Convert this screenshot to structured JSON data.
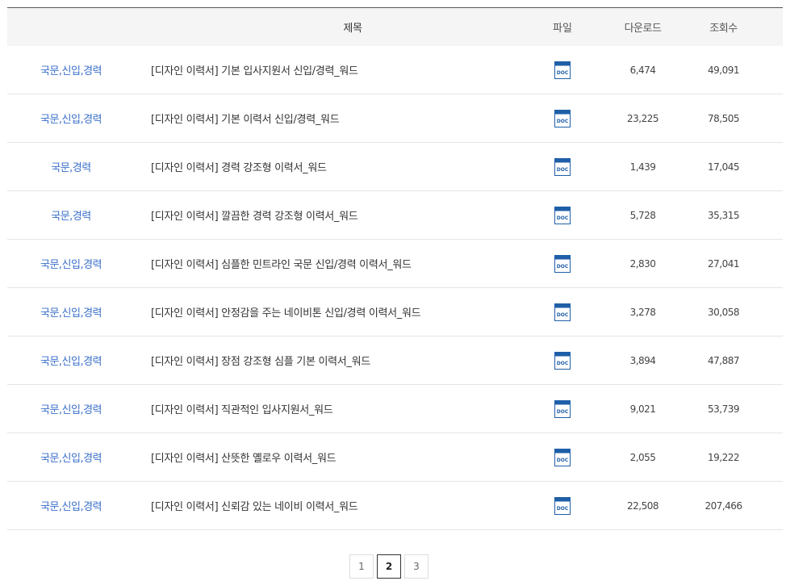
{
  "table": {
    "headers": {
      "category": "",
      "title": "제목",
      "file": "파일",
      "downloads": "다운로드",
      "views": "조회수"
    },
    "rows": [
      {
        "category": "국문,신입,경력",
        "title": "[디자인 이력서] 기본 입사지원서 신입/경력_워드",
        "file_icon": "doc-file-icon",
        "downloads": "6,474",
        "views": "49,091"
      },
      {
        "category": "국문,신입,경력",
        "title": "[디자인 이력서] 기본 이력서 신입/경력_워드",
        "file_icon": "doc-file-icon",
        "downloads": "23,225",
        "views": "78,505"
      },
      {
        "category": "국문,경력",
        "title": "[디자인 이력서] 경력 강조형 이력서_워드",
        "file_icon": "doc-file-icon",
        "downloads": "1,439",
        "views": "17,045"
      },
      {
        "category": "국문,경력",
        "title": "[디자인 이력서] 깔끔한 경력 강조형 이력서_워드",
        "file_icon": "doc-file-icon",
        "downloads": "5,728",
        "views": "35,315"
      },
      {
        "category": "국문,신입,경력",
        "title": "[디자인 이력서] 심플한 민트라인 국문 신입/경력 이력서_워드",
        "file_icon": "doc-file-icon",
        "downloads": "2,830",
        "views": "27,041"
      },
      {
        "category": "국문,신입,경력",
        "title": "[디자인 이력서] 안정감을 주는 네이비톤 신입/경력 이력서_워드",
        "file_icon": "doc-file-icon",
        "downloads": "3,278",
        "views": "30,058"
      },
      {
        "category": "국문,신입,경력",
        "title": "[디자인 이력서] 장점 강조형 심플 기본 이력서_워드",
        "file_icon": "doc-file-icon",
        "downloads": "3,894",
        "views": "47,887"
      },
      {
        "category": "국문,신입,경력",
        "title": "[디자인 이력서] 직관적인 입사지원서_워드",
        "file_icon": "doc-file-icon",
        "downloads": "9,021",
        "views": "53,739"
      },
      {
        "category": "국문,신입,경력",
        "title": "[디자인 이력서] 산뜻한 옐로우 이력서_워드",
        "file_icon": "doc-file-icon",
        "downloads": "2,055",
        "views": "19,222"
      },
      {
        "category": "국문,신입,경력",
        "title": "[디자인 이력서] 신뢰감 있는 네이비 이력서_워드",
        "file_icon": "doc-file-icon",
        "downloads": "22,508",
        "views": "207,466"
      }
    ]
  },
  "doc_icon_label": "DOC",
  "colors": {
    "category_link": "#3a6fc9",
    "doc_icon": "#1f5fa8",
    "header_bg": "#f5f5f5"
  },
  "pagination": {
    "pages": [
      "1",
      "2",
      "3"
    ],
    "current": "2"
  }
}
